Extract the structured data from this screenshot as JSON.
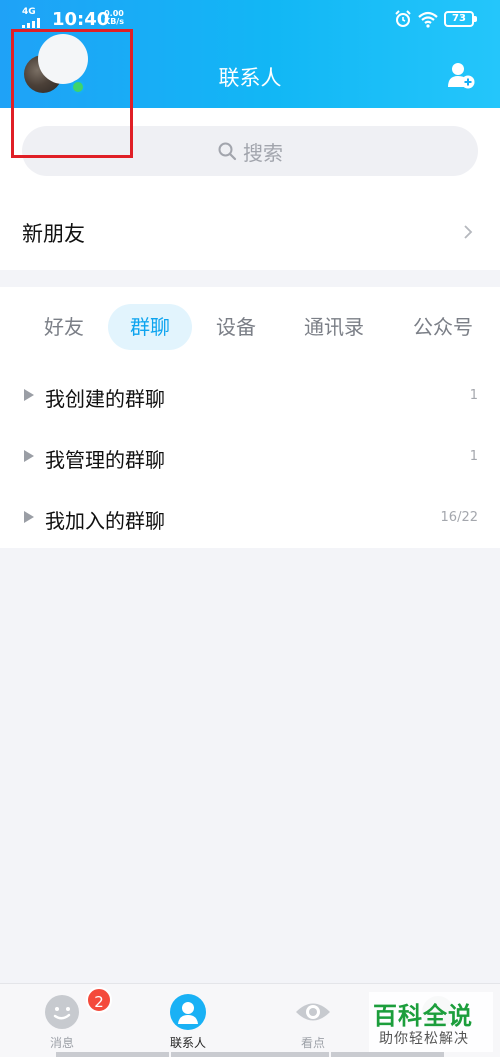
{
  "status_bar": {
    "network": "4G",
    "time": "10:40",
    "speed_value": "0.00",
    "speed_unit": "KB/s",
    "battery": "73"
  },
  "header": {
    "title": "联系人",
    "avatar_icon": "user-avatar",
    "add_contact_icon": "add-contact-icon"
  },
  "search": {
    "placeholder": "搜索",
    "icon": "search-icon"
  },
  "new_friends": {
    "label": "新朋友"
  },
  "tabs": [
    {
      "label": "好友",
      "active": false
    },
    {
      "label": "群聊",
      "active": true
    },
    {
      "label": "设备",
      "active": false
    },
    {
      "label": "通讯录",
      "active": false
    },
    {
      "label": "公众号",
      "active": false
    }
  ],
  "groups": [
    {
      "name": "我创建的群聊",
      "count": "1"
    },
    {
      "name": "我管理的群聊",
      "count": "1"
    },
    {
      "name": "我加入的群聊",
      "count": "16/22"
    }
  ],
  "bottom_nav": [
    {
      "label": "消息",
      "icon": "message-icon",
      "badge": "2",
      "active": false
    },
    {
      "label": "联系人",
      "icon": "contacts-icon",
      "active": true
    },
    {
      "label": "看点",
      "icon": "eye-icon",
      "active": false
    },
    {
      "label": "",
      "icon": "dynamic-icon",
      "active": false
    }
  ],
  "watermark": {
    "main": "百科全说",
    "sub": "助你轻松解决"
  },
  "colors": {
    "accent": "#12b7f5",
    "tab_active_text": "#0ea4ef",
    "badge": "#f44a3b",
    "annotation": "#e01f26"
  }
}
